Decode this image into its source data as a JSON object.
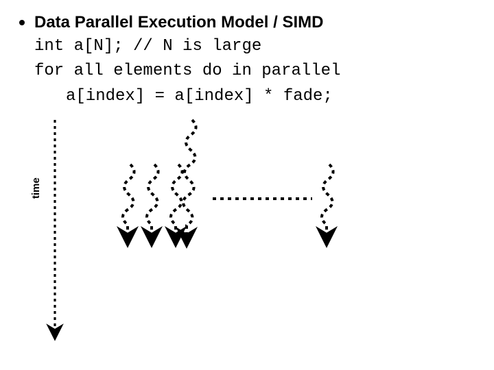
{
  "title": "Data Parallel Execution Model / SIMD",
  "code": {
    "line1": "int a[N]; // N is large",
    "line2": "for all elements do in parallel",
    "line3": "a[index] = a[index] * fade;"
  },
  "axis_label": "time",
  "diagram": {
    "description": "A dotted vertical time axis on the left with an arrowhead at the bottom. Several dotted squiggly arrows of varying lengths descend in parallel, representing data-parallel threads. One thread starts earlier (higher) and is longer; a group of three shorter squiggles run side by side; a dotted horizontal ellipsis separates them from another squiggle on the right."
  }
}
